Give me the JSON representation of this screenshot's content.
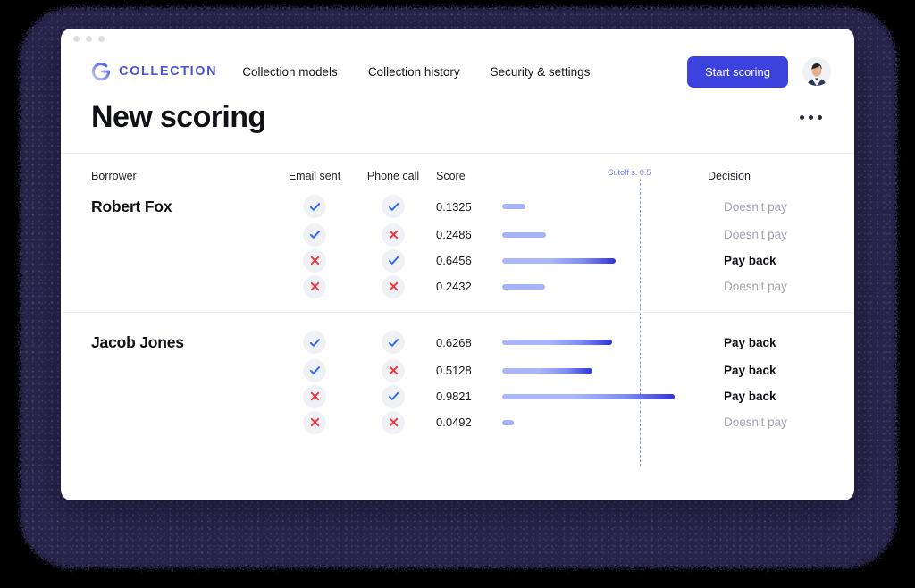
{
  "window": {
    "traffic_dots": 3
  },
  "nav": {
    "brand": "COLLECTION",
    "brand_icon": "g-logo-icon",
    "links": [
      {
        "label": "Collection models"
      },
      {
        "label": "Collection history"
      },
      {
        "label": "Security & settings"
      }
    ],
    "cta_label": "Start scoring",
    "cta_color": "#3C42DD",
    "avatar_icon": "user-avatar"
  },
  "header": {
    "title": "New scoring",
    "more_icon": "ellipsis-horizontal-icon"
  },
  "table": {
    "columns": {
      "borrower": "Borrower",
      "email_sent": "Email sent",
      "phone_call": "Phone call",
      "score": "Score",
      "decision": "Decision"
    },
    "cutoff_label": "Cutoff s. 0.5",
    "cutoff_value": 0.5,
    "cutoff_color": "#6E7BF2",
    "decision_pay": "Pay back",
    "decision_nopay": "Doesn't pay",
    "groups": [
      {
        "borrower": "Robert Fox",
        "rows": [
          {
            "email_sent": true,
            "phone_call": true,
            "score": "0.1325",
            "value": 0.1325,
            "decision": "Doesn't pay",
            "pays": false
          },
          {
            "email_sent": true,
            "phone_call": false,
            "score": "0.2486",
            "value": 0.2486,
            "decision": "Doesn't pay",
            "pays": false
          },
          {
            "email_sent": false,
            "phone_call": true,
            "score": "0.6456",
            "value": 0.6456,
            "decision": "Pay back",
            "pays": true
          },
          {
            "email_sent": false,
            "phone_call": false,
            "score": "0.2432",
            "value": 0.2432,
            "decision": "Doesn't pay",
            "pays": false
          }
        ]
      },
      {
        "borrower": "Jacob Jones",
        "rows": [
          {
            "email_sent": true,
            "phone_call": true,
            "score": "0.6268",
            "value": 0.6268,
            "decision": "Pay back",
            "pays": true
          },
          {
            "email_sent": true,
            "phone_call": false,
            "score": "0.5128",
            "value": 0.5128,
            "decision": "Pay back",
            "pays": true
          },
          {
            "email_sent": false,
            "phone_call": true,
            "score": "0.9821",
            "value": 0.9821,
            "decision": "Pay back",
            "pays": true
          },
          {
            "email_sent": false,
            "phone_call": false,
            "score": "0.0492",
            "value": 0.0492,
            "decision": "Doesn't pay",
            "pays": false
          }
        ]
      }
    ]
  },
  "chart_data": {
    "type": "bar",
    "title": "New scoring",
    "xlabel": "Score",
    "ylabel": "",
    "xlim": [
      0,
      1
    ],
    "grid": false,
    "annotations": [
      {
        "text": "Cutoff s. 0.5",
        "x": 0.5,
        "type": "vline-dashed",
        "color": "#6E7BF2"
      }
    ],
    "categories": [
      "Robert Fox / email+phone",
      "Robert Fox / email",
      "Robert Fox / phone",
      "Robert Fox / none",
      "Jacob Jones / email+phone",
      "Jacob Jones / email",
      "Jacob Jones / phone",
      "Jacob Jones / none"
    ],
    "values": [
      0.1325,
      0.2486,
      0.6456,
      0.2432,
      0.6268,
      0.5128,
      0.9821,
      0.0492
    ]
  }
}
